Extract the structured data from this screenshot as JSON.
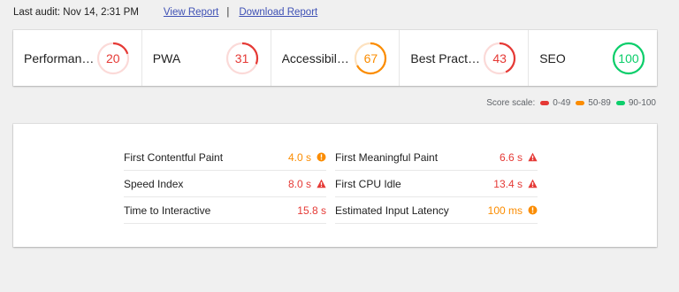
{
  "header": {
    "audit_text": "Last audit: Nov 14, 2:31 PM",
    "view_report": "View Report",
    "separator": "|",
    "download_report": "Download Report"
  },
  "colors": {
    "fail": "#e53935",
    "average": "#fb8c00",
    "pass": "#0cce6b",
    "link": "#3f51b5"
  },
  "scores": [
    {
      "label": "Performance",
      "display_label": "Performan…",
      "score": 20,
      "level": "fail"
    },
    {
      "label": "PWA",
      "display_label": "PWA",
      "score": 31,
      "level": "fail"
    },
    {
      "label": "Accessibility",
      "display_label": "Accessibil…",
      "score": 67,
      "level": "average"
    },
    {
      "label": "Best Practices",
      "display_label": "Best Pract…",
      "score": 43,
      "level": "fail"
    },
    {
      "label": "SEO",
      "display_label": "SEO",
      "score": 100,
      "level": "pass"
    }
  ],
  "score_scale": {
    "label": "Score scale:",
    "ranges": [
      {
        "label": "0-49",
        "level": "fail"
      },
      {
        "label": "50-89",
        "level": "average"
      },
      {
        "label": "90-100",
        "level": "pass"
      }
    ]
  },
  "metrics": {
    "left": [
      {
        "name": "First Contentful Paint",
        "value": "4.0 s",
        "level": "average",
        "icon": "info-circle-icon"
      },
      {
        "name": "Speed Index",
        "value": "8.0 s",
        "level": "fail",
        "icon": "warning-triangle-icon"
      },
      {
        "name": "Time to Interactive",
        "value": "15.8 s",
        "level": "fail",
        "icon": "none"
      }
    ],
    "right": [
      {
        "name": "First Meaningful Paint",
        "value": "6.6 s",
        "level": "fail",
        "icon": "warning-triangle-icon"
      },
      {
        "name": "First CPU Idle",
        "value": "13.4 s",
        "level": "fail",
        "icon": "warning-triangle-icon"
      },
      {
        "name": "Estimated Input Latency",
        "value": "100 ms",
        "level": "average",
        "icon": "info-circle-icon"
      }
    ]
  }
}
